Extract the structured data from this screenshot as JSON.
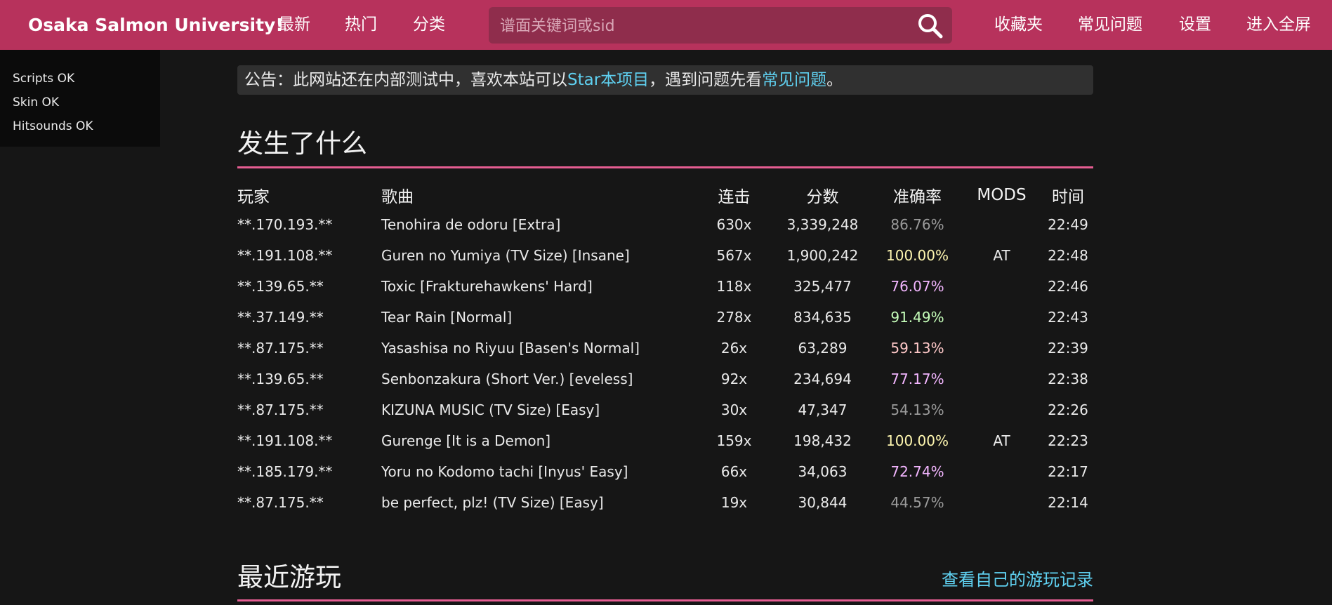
{
  "header": {
    "brand": "Osaka Salmon University!",
    "nav_latest": "最新",
    "nav_hot": "热门",
    "nav_category": "分类",
    "search_placeholder": "谱面关键词或sid",
    "nav_favorites": "收藏夹",
    "nav_faq": "常见问题",
    "nav_settings": "设置",
    "nav_fullscreen": "进入全屏"
  },
  "status": {
    "lines": [
      "Scripts OK",
      "Skin OK",
      "Hitsounds OK"
    ]
  },
  "notice": {
    "prefix": "公告：此网站还在内部测试中，喜欢本站可以",
    "link1": "Star本项目",
    "middle": "，遇到问题先看",
    "link2": "常见问题",
    "suffix": "。"
  },
  "whats_happening": {
    "title": "发生了什么",
    "headers": [
      "玩家",
      "歌曲",
      "连击",
      "分数",
      "准确率",
      "MODS",
      "时间"
    ],
    "rows": [
      {
        "player": "**.170.193.**",
        "song": "Tenohira de odoru [Extra]",
        "combo": "630x",
        "score": "3,339,248",
        "acc": "86.76%",
        "acc_color": "#9a9a9a",
        "mods": "",
        "time": "22:49"
      },
      {
        "player": "**.191.108.**",
        "song": "Guren no Yumiya (TV Size) [Insane]",
        "combo": "567x",
        "score": "1,900,242",
        "acc": "100.00%",
        "acc_color": "#fff7b0",
        "mods": "AT",
        "time": "22:48"
      },
      {
        "player": "**.139.65.**",
        "song": "Toxic [Frakturehawkens' Hard]",
        "combo": "118x",
        "score": "325,477",
        "acc": "76.07%",
        "acc_color": "#f3b6ff",
        "mods": "",
        "time": "22:46"
      },
      {
        "player": "**.37.149.**",
        "song": "Tear Rain [Normal]",
        "combo": "278x",
        "score": "834,635",
        "acc": "91.49%",
        "acc_color": "#c6ffba",
        "mods": "",
        "time": "22:43"
      },
      {
        "player": "**.87.175.**",
        "song": "Yasashisa no Riyuu [Basen's Normal]",
        "combo": "26x",
        "score": "63,289",
        "acc": "59.13%",
        "acc_color": "#ffc9c9",
        "mods": "",
        "time": "22:39"
      },
      {
        "player": "**.139.65.**",
        "song": "Senbonzakura (Short Ver.) [eveless]",
        "combo": "92x",
        "score": "234,694",
        "acc": "77.17%",
        "acc_color": "#f3b6ff",
        "mods": "",
        "time": "22:38"
      },
      {
        "player": "**.87.175.**",
        "song": "KIZUNA MUSIC (TV Size) [Easy]",
        "combo": "30x",
        "score": "47,347",
        "acc": "54.13%",
        "acc_color": "#9a9a9a",
        "mods": "",
        "time": "22:26"
      },
      {
        "player": "**.191.108.**",
        "song": "Gurenge [It is a Demon]",
        "combo": "159x",
        "score": "198,432",
        "acc": "100.00%",
        "acc_color": "#fff7b0",
        "mods": "AT",
        "time": "22:23"
      },
      {
        "player": "**.185.179.**",
        "song": "Yoru no Kodomo tachi [Inyus' Easy]",
        "combo": "66x",
        "score": "34,063",
        "acc": "72.74%",
        "acc_color": "#f3b6ff",
        "mods": "",
        "time": "22:17"
      },
      {
        "player": "**.87.175.**",
        "song": "be perfect, plz! (TV Size) [Easy]",
        "combo": "19x",
        "score": "30,844",
        "acc": "44.57%",
        "acc_color": "#9a9a9a",
        "mods": "",
        "time": "22:14"
      }
    ]
  },
  "recent": {
    "title": "最近游玩",
    "history_link": "查看自己的游玩记录"
  },
  "colors": {
    "brand": "#b7325c",
    "accent_rule": "#e55d92",
    "link": "#5fd0f0"
  }
}
